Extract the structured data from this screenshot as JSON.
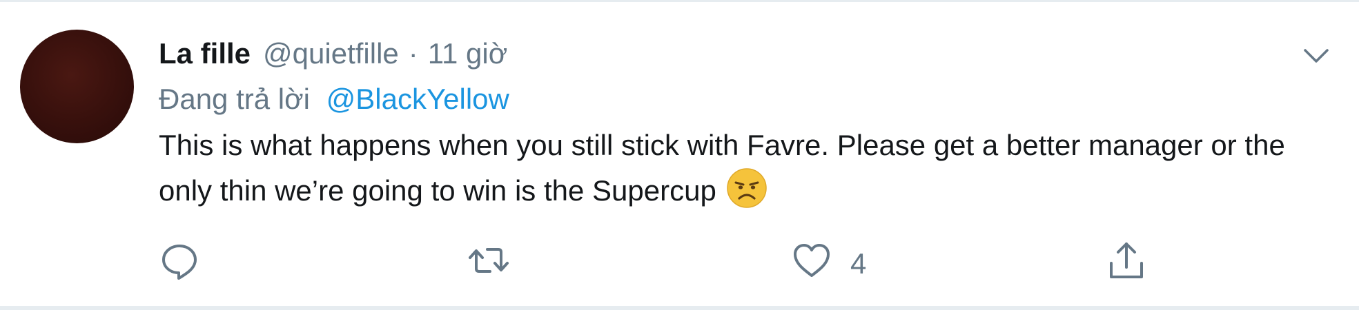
{
  "tweet": {
    "display_name": "La fille",
    "handle": "@quietfille",
    "separator": "·",
    "time": "11 giờ",
    "reply_prefix": "Đang trả lời",
    "reply_to": "@BlackYellow",
    "text": "This is what happens when you still stick with Favre. Please get a better manager or the only thin we’re going to win is the Supercup",
    "emoji": "frowning-face-emoji",
    "likes": "4"
  },
  "icons": {
    "reply": "comment-icon",
    "retweet": "retweet-icon",
    "like": "heart-icon",
    "share": "share-icon",
    "menu": "chevron-down-icon"
  },
  "colors": {
    "link": "#1b95e0",
    "secondary_text": "#657786",
    "primary_text": "#14171a",
    "border": "#e6ecf0",
    "emoji": "#f5c33b"
  }
}
